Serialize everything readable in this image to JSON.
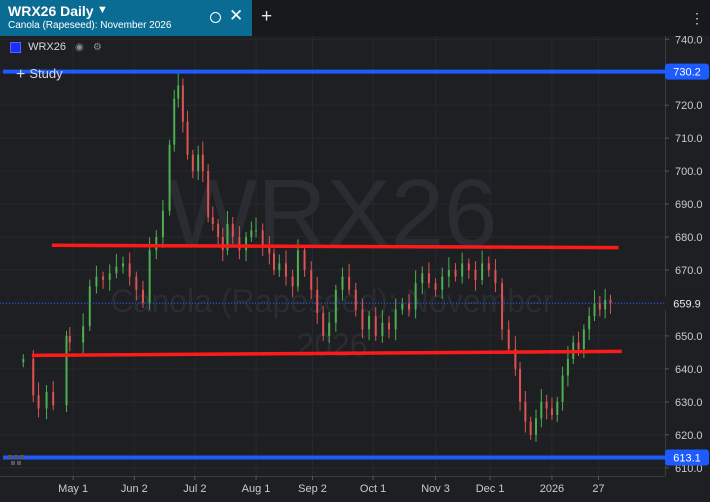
{
  "tab": {
    "title": "WRX26 Daily",
    "subtitle": "Canola (Rapeseed): November 2026",
    "caret_icon": "caret-down-icon",
    "ring_icon": "circle-icon",
    "close_icon": "close-icon"
  },
  "toolbar": {
    "new_tab_icon": "plus-icon",
    "menu_icon": "kebab-menu-icon"
  },
  "legend": {
    "symbol": "WRX26",
    "swatch_color": "#1f2cff",
    "visibility_icon": "eye-icon",
    "settings_icon": "gear-icon"
  },
  "study_button": {
    "label": "Study",
    "icon": "plus-icon"
  },
  "watermark": {
    "symbol": "WRX26",
    "line1": "Canola (Rapeseed): November",
    "line2": "2026"
  },
  "colors": {
    "up": "#4caf50",
    "down": "#e05252",
    "support_resistance": "#ff1a1a",
    "horizontal_level": "#1e5bff",
    "last_price": "#1e5bff",
    "background": "#1e1f23"
  },
  "chart_data": {
    "type": "candlestick",
    "symbol": "WRX26",
    "y_ticks": [
      740,
      730,
      720,
      710,
      700,
      690,
      680,
      670,
      660,
      650,
      640,
      630,
      620,
      610
    ],
    "ylim": [
      607.5,
      741
    ],
    "x_ticks": [
      "May 1",
      "Jun 2",
      "Jul 2",
      "Aug 1",
      "Sep 2",
      "Oct 1",
      "Nov 3",
      "Dec 1",
      "2026",
      "27"
    ],
    "horizontal_levels": [
      {
        "value": 730.2,
        "label": "730.2"
      },
      {
        "value": 613.1,
        "label": "613.1"
      }
    ],
    "last_price": {
      "value": 659.9,
      "label": "659.9"
    },
    "trendlines": [
      {
        "from": [
          0.078,
          677.5
        ],
        "to": [
          0.93,
          676.8
        ]
      },
      {
        "from": [
          0.048,
          644.1
        ],
        "to": [
          0.935,
          645.3
        ]
      }
    ],
    "x_tick_positions": [
      0.11,
      0.202,
      0.293,
      0.385,
      0.47,
      0.561,
      0.655,
      0.737,
      0.83,
      0.9
    ],
    "candles": [
      [
        0.035,
        643
      ],
      [
        0.05,
        632
      ],
      [
        0.058,
        628
      ],
      [
        0.07,
        633
      ],
      [
        0.08,
        629
      ],
      [
        0.1,
        650
      ],
      [
        0.105,
        648
      ],
      [
        0.125,
        653
      ],
      [
        0.135,
        665
      ],
      [
        0.145,
        668
      ],
      [
        0.155,
        667
      ],
      [
        0.165,
        669
      ],
      [
        0.175,
        671
      ],
      [
        0.185,
        672
      ],
      [
        0.195,
        668
      ],
      [
        0.205,
        664
      ],
      [
        0.215,
        660
      ],
      [
        0.225,
        676
      ],
      [
        0.235,
        680
      ],
      [
        0.245,
        688
      ],
      [
        0.255,
        708
      ],
      [
        0.262,
        722
      ],
      [
        0.268,
        726
      ],
      [
        0.275,
        715
      ],
      [
        0.282,
        705
      ],
      [
        0.29,
        700
      ],
      [
        0.298,
        705
      ],
      [
        0.305,
        700
      ],
      [
        0.313,
        686
      ],
      [
        0.32,
        684
      ],
      [
        0.328,
        680
      ],
      [
        0.335,
        676
      ],
      [
        0.342,
        684
      ],
      [
        0.35,
        680
      ],
      [
        0.36,
        676
      ],
      [
        0.37,
        680
      ],
      [
        0.378,
        682
      ],
      [
        0.385,
        682
      ],
      [
        0.395,
        677
      ],
      [
        0.405,
        675
      ],
      [
        0.412,
        670
      ],
      [
        0.42,
        672
      ],
      [
        0.43,
        668
      ],
      [
        0.44,
        665
      ],
      [
        0.448,
        676
      ],
      [
        0.458,
        670
      ],
      [
        0.468,
        664
      ],
      [
        0.477,
        657
      ],
      [
        0.486,
        650
      ],
      [
        0.495,
        654
      ],
      [
        0.505,
        664
      ],
      [
        0.515,
        668
      ],
      [
        0.525,
        664
      ],
      [
        0.535,
        658
      ],
      [
        0.545,
        652
      ],
      [
        0.555,
        656
      ],
      [
        0.565,
        650
      ],
      [
        0.575,
        654
      ],
      [
        0.585,
        652
      ],
      [
        0.595,
        658
      ],
      [
        0.605,
        660
      ],
      [
        0.615,
        658
      ],
      [
        0.625,
        666
      ],
      [
        0.635,
        669
      ],
      [
        0.645,
        666
      ],
      [
        0.655,
        664
      ],
      [
        0.665,
        668
      ],
      [
        0.675,
        670
      ],
      [
        0.685,
        668
      ],
      [
        0.695,
        672
      ],
      [
        0.705,
        670
      ],
      [
        0.715,
        667
      ],
      [
        0.725,
        672
      ],
      [
        0.735,
        670
      ],
      [
        0.745,
        666
      ],
      [
        0.755,
        652
      ],
      [
        0.765,
        646
      ],
      [
        0.775,
        640
      ],
      [
        0.782,
        630
      ],
      [
        0.79,
        624
      ],
      [
        0.798,
        620
      ],
      [
        0.806,
        625
      ],
      [
        0.814,
        630
      ],
      [
        0.822,
        628
      ],
      [
        0.83,
        626
      ],
      [
        0.838,
        630
      ],
      [
        0.846,
        638
      ],
      [
        0.854,
        643
      ],
      [
        0.862,
        648
      ],
      [
        0.87,
        646
      ],
      [
        0.878,
        652
      ],
      [
        0.886,
        656
      ],
      [
        0.894,
        660
      ],
      [
        0.902,
        658
      ],
      [
        0.91,
        661
      ],
      [
        0.918,
        660
      ]
    ]
  }
}
